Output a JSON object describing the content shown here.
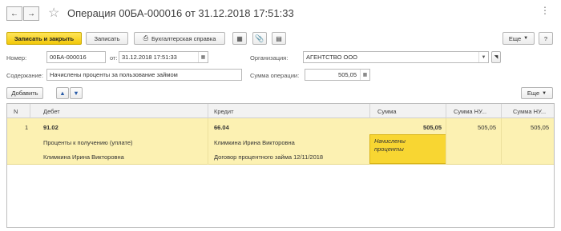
{
  "window": {
    "title": "Операция 00БА-000016 от 31.12.2018 17:51:33"
  },
  "toolbar": {
    "post_close_label": "Записать и закрыть",
    "save_label": "Записать",
    "print_label": "Бухгалтерская справка",
    "more_label": "Еще"
  },
  "form": {
    "number_label": "Номер:",
    "number_value": "00БА-000016",
    "date_label": "от:",
    "date_value": "31.12.2018 17:51:33",
    "org_label": "Организация:",
    "org_value": "АГЕНТСТВО ООО",
    "content_label": "Содержание:",
    "content_value": "Начислены проценты за пользование займом",
    "sum_label": "Сумма операции:",
    "sum_value": "505,05"
  },
  "table_toolbar": {
    "add_label": "Добавить",
    "more_label": "Еще"
  },
  "table": {
    "columns": [
      "N",
      "Дебет",
      "Кредит",
      "Сумма",
      "Сумма НУ...",
      "Сумма НУ..."
    ],
    "rows": [
      {
        "n": "1",
        "debit_account": "91.02",
        "debit_sub1": "Проценты к получению (уплате)",
        "debit_sub2": "Климкина Ирина Викторовна",
        "credit_account": "66.04",
        "credit_sub1": "Климкина Ирина Викторовна",
        "credit_sub2": "Договор процентного займа 12/11/2018",
        "amount": "505,05",
        "content": "Начислены проценты",
        "amount_nu_dt": "505,05",
        "amount_nu_kt": "505,05"
      }
    ]
  },
  "colors": {
    "row_highlight": "#fcf1b2",
    "selected_cell": "#f8d632",
    "primary_button": "#f2c80a"
  }
}
